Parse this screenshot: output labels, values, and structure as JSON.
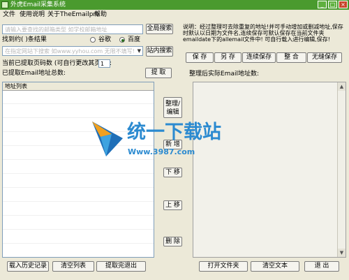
{
  "window": {
    "title": "外虎Email采集系统",
    "min_label": "_",
    "max_label": "□",
    "close_label": "×"
  },
  "menu": [
    "文件",
    "使用说明",
    "关于TheEmailpro",
    "帮助"
  ],
  "search": {
    "keyword_placeholder": "请输入要查找的邮箱类型 如学校邮箱地址",
    "global_search_label": "全局搜索"
  },
  "results": {
    "found_label": "找到约( )条结果",
    "engines": [
      {
        "label": "谷歌",
        "selected": false
      },
      {
        "label": "百度",
        "selected": true
      }
    ]
  },
  "site": {
    "placeholder": "在指定网站下搜索 如www.yyhou.com 无限不填写!",
    "site_search_label": "站内搜索"
  },
  "pages": {
    "label": "当前已提取页码数 (可自行更改其页码):",
    "value": "1"
  },
  "extract": {
    "count_label": "已提取Email地址总数:",
    "extract_button": "提 取"
  },
  "list": {
    "header": "地址列表"
  },
  "middle_buttons": {
    "organize": "整理/编辑",
    "new": "新 增",
    "down": "下 移",
    "up": "上 移",
    "delete": "删 除"
  },
  "instructions": "说明：经过整理可去除重复的地址!并可手动增加或删减地址,保存时默认以日期为文件名,连续保存可默认保存在当前文件夹emaildate下的allemail文件中! 可自行载入进行编辑,保存!",
  "save_buttons": [
    "保 存",
    "另 存",
    "连续保存",
    "整 合",
    "无缝保存"
  ],
  "organized": {
    "label": "整理后实际Email地址数:"
  },
  "bottom_left": [
    "载入历史记录",
    "清空列表",
    "提取完退出"
  ],
  "bottom_right": [
    "打开文件夹",
    "清空文本",
    "退 出"
  ],
  "watermark": {
    "main": "统一下载站",
    "sub": "Www.3987.com"
  }
}
